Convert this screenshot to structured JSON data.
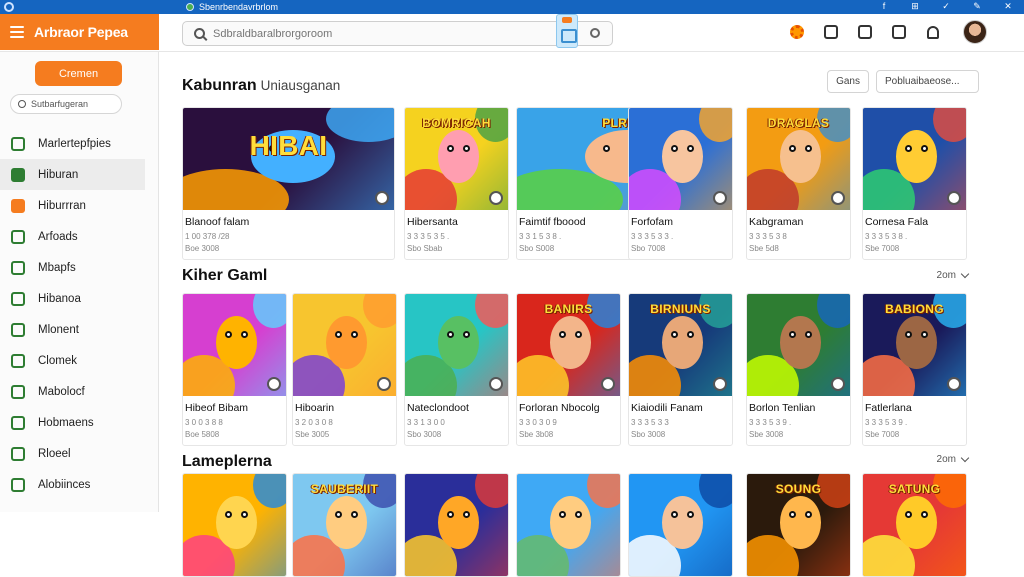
{
  "titlebar": {
    "url": "Sbenrbendavrbrlom",
    "sys_icons": [
      "f",
      "⊞",
      "✓",
      "✎",
      "✕"
    ]
  },
  "header": {
    "brand": "Arbraor Pepea",
    "search_placeholder": "Sdbraldbaralbrorgoroom"
  },
  "sidebar": {
    "cta_label": "Cremen",
    "search_placeholder": "Sutbarfugeran",
    "items": [
      {
        "label": "Marlertepfpies",
        "icon": "gamepad-icon",
        "color": "#2e7d32"
      },
      {
        "label": "Hiburan",
        "icon": "controller-icon",
        "color": "#2e7d32",
        "active": true
      },
      {
        "label": "Hiburrran",
        "icon": "fire-icon",
        "color": "#f57c1f"
      },
      {
        "label": "Arfoads",
        "icon": "star-icon",
        "color": "#2e7d32"
      },
      {
        "label": "Mbapfs",
        "icon": "grid-icon",
        "color": "#2e7d32"
      },
      {
        "label": "Hibanoa",
        "icon": "calendar-icon",
        "color": "#2e7d32"
      },
      {
        "label": "Mlonent",
        "icon": "clock-icon",
        "color": "#2e7d32"
      },
      {
        "label": "Clomek",
        "icon": "trophy-icon",
        "color": "#2e7d32"
      },
      {
        "label": "Mabolocf",
        "icon": "globe-icon",
        "color": "#2e7d32"
      },
      {
        "label": "Hobmaens",
        "icon": "tag-icon",
        "color": "#2e7d32"
      },
      {
        "label": "Rloeel",
        "icon": "sparkle-icon",
        "color": "#2e7d32"
      },
      {
        "label": "Alobiinces",
        "icon": "table-icon",
        "color": "#2e7d32"
      }
    ]
  },
  "sections": [
    {
      "title": "Kabunran",
      "subtitle": "Uniausganan",
      "filters": [
        "Gans",
        "Pobluaibaeose..."
      ],
      "cards": [
        {
          "title": "Blanoof falam",
          "sub1": "1 00 378 /28",
          "sub2": "Boe 3008",
          "thumb_text": "HIBAI",
          "bg": "#2a0f3d",
          "c1": "#ff9e00",
          "c2": "#3fb0ff",
          "face": "#43b0ff",
          "wide": true
        },
        {
          "title": "Hibersanta",
          "sub1": "3 3 3 5 3 5 .",
          "sub2": "Sbo Sbab",
          "thumb_text": "BOMRICAH",
          "bg": "#f5d21f",
          "c1": "#e53935",
          "c2": "#43a047",
          "face": "#ff9eb0"
        },
        {
          "title": "Faimtif fboood",
          "sub1": "3 3 1 5 3 8 .",
          "sub2": "Sbo S008",
          "thumb_text": "PLRES",
          "bg": "#39a3e8",
          "c1": "#5bd13f",
          "c2": "#ff6f3c",
          "face": "#f7b98c",
          "wide": true
        },
        {
          "title": "Forfofam",
          "sub1": "3 3 3 5 3 3 .",
          "sub2": "Sbo 7008",
          "thumb_text": "",
          "bg": "#2b6fd6",
          "c1": "#d64bff",
          "c2": "#ffa726",
          "face": "#f7c59f"
        },
        {
          "title": "Kabgraman",
          "sub1": "3 3 3 5 3 8",
          "sub2": "Sbe 5d8",
          "thumb_text": "DRAGLAS",
          "bg": "#f39c12",
          "c1": "#c0392b",
          "c2": "#3b8fd0",
          "face": "#f6c08e"
        },
        {
          "title": "Cornesa Fala",
          "sub1": "3 3 3 5 3 8 .",
          "sub2": "Sbe 7008",
          "thumb_text": "",
          "bg": "#1f4fa8",
          "c1": "#2ecc71",
          "c2": "#e74c3c",
          "face": "#ffcc33"
        }
      ]
    },
    {
      "title": "Kiher Gaml",
      "see_more": "2om",
      "cards": [
        {
          "title": "Hibeof Bibam",
          "sub1": "3 0 0 3 8 8",
          "sub2": "Boe 5808",
          "thumb_text": "",
          "bg": "#d63fd0",
          "c1": "#ffb300",
          "c2": "#5ad6ff",
          "face": "#ffb300"
        },
        {
          "title": "Hiboarin",
          "sub1": "3 2 0 3 0 8",
          "sub2": "Sbe 3005",
          "thumb_text": "",
          "bg": "#f7c52f",
          "c1": "#7b3fd6",
          "c2": "#ff9a2f",
          "face": "#ff9a2f"
        },
        {
          "title": "Nateclondoot",
          "sub1": "3 3 1 3 0 0",
          "sub2": "Sbo 3008",
          "thumb_text": "",
          "bg": "#27c5c5",
          "c1": "#4caf50",
          "c2": "#ff5252",
          "face": "#58c063"
        },
        {
          "title": "Forloran Nbocolg",
          "sub1": "3 3 0 3 0 9",
          "sub2": "Sbe 3b08",
          "thumb_text": "BANIRS",
          "bg": "#d9261c",
          "c1": "#ffca28",
          "c2": "#1e88e5",
          "face": "#f3b58a"
        },
        {
          "title": "Kiaiodili Fanam",
          "sub1": "3 3 3 5 3 3",
          "sub2": "Sbo 3008",
          "thumb_text": "BIRNIUNS",
          "bg": "#163a7a",
          "c1": "#ff8f00",
          "c2": "#26a69a",
          "face": "#e7a778"
        },
        {
          "title": "Borlon Tenlian",
          "sub1": "3 3 3 5 3 9 .",
          "sub2": "Sbe 3008",
          "thumb_text": "",
          "bg": "#2e7d32",
          "c1": "#c6ff00",
          "c2": "#1565c0",
          "face": "#b3774e"
        },
        {
          "title": "Fatlerlana",
          "sub1": "3 3 3 5 3 9 .",
          "sub2": "Sbe 7008",
          "thumb_text": "BABIONG",
          "bg": "#1a1a5a",
          "c1": "#ff7043",
          "c2": "#29b6f6",
          "face": "#9c6644"
        }
      ]
    },
    {
      "title": "Lameplerna",
      "see_more": "2om",
      "cards": [
        {
          "title": "",
          "sub1": "",
          "sub2": "",
          "thumb_text": "",
          "bg": "#ffb300",
          "c1": "#ff4081",
          "c2": "#1e88e5",
          "face": "#ffd54f"
        },
        {
          "title": "",
          "sub1": "",
          "sub2": "",
          "thumb_text": "SAUBERIIT",
          "bg": "#7ec8f0",
          "c1": "#ff7043",
          "c2": "#3949ab",
          "face": "#ffcc80"
        },
        {
          "title": "",
          "sub1": "",
          "sub2": "",
          "thumb_text": "",
          "bg": "#2a2e9a",
          "c1": "#ffca28",
          "c2": "#e53935",
          "face": "#ffa726"
        },
        {
          "title": "",
          "sub1": "",
          "sub2": "",
          "thumb_text": "",
          "bg": "#3fa9f5",
          "c1": "#66bb6a",
          "c2": "#ff7043",
          "face": "#ffcc80"
        },
        {
          "title": "",
          "sub1": "",
          "sub2": "",
          "thumb_text": "",
          "bg": "#2196f3",
          "c1": "#ffffff",
          "c2": "#0d47a1",
          "face": "#f5c29a"
        },
        {
          "title": "",
          "sub1": "",
          "sub2": "",
          "thumb_text": "SOUNG",
          "bg": "#2b1a0c",
          "c1": "#ff9800",
          "c2": "#d84315",
          "face": "#ffb74d"
        },
        {
          "title": "",
          "sub1": "",
          "sub2": "",
          "thumb_text": "SATUNG",
          "bg": "#e53935",
          "c1": "#ffeb3b",
          "c2": "#ff6f00",
          "face": "#ffca28"
        }
      ]
    }
  ]
}
